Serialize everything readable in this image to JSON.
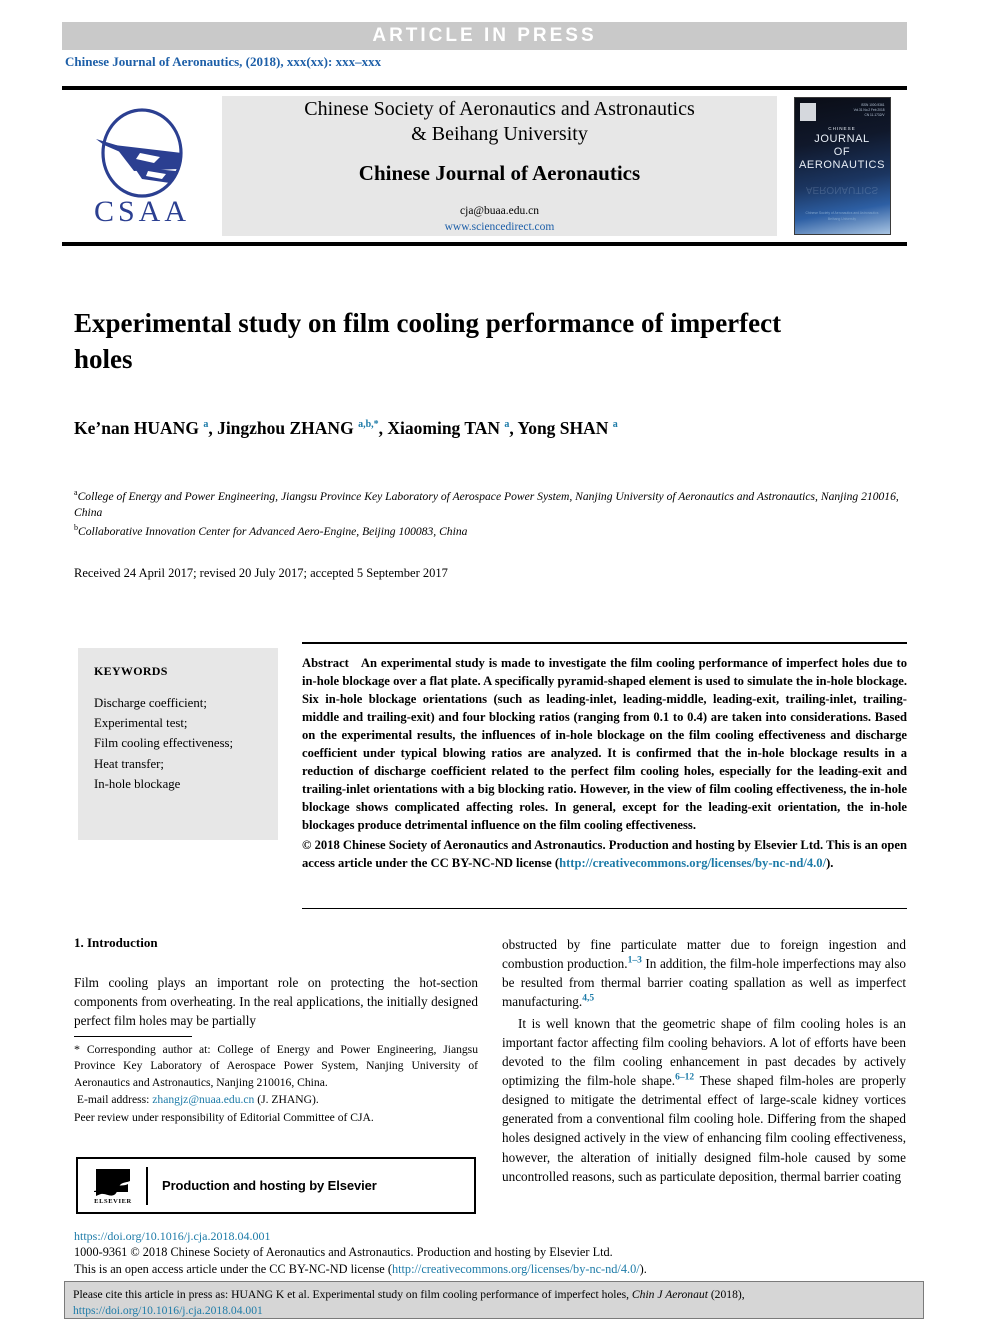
{
  "banner": {
    "text": "ARTICLE  IN  PRESS"
  },
  "running_head": "Chinese Journal of Aeronautics, (2018), xxx(xx): xxx–xxx",
  "masthead": {
    "logo_text": "CSAA",
    "society_line1": "Chinese Society of Aeronautics and Astronautics",
    "society_line2": "& Beihang University",
    "journal_name": "Chinese Journal of Aeronautics",
    "email": "cja@buaa.edu.cn",
    "url": "www.sciencedirect.com",
    "cover": {
      "chinese_label": "CHINESE",
      "title_line1": "JOURNAL",
      "title_line2": "OF",
      "title_line3": "AERONAUTICS",
      "issue_info": "ISSN 1000-9361\nVol. 31 No. 2 February 2018\nCN 11-1732/V",
      "foot_line1": "Chinese Society of Aeronautics and Astronautics",
      "foot_line2": "Beihang University"
    }
  },
  "article": {
    "title": "Experimental study on film cooling performance of imperfect holes",
    "authors_html": "Ke’nan HUANG <sup>a</sup>, Jingzhou ZHANG <sup>a,b,</sup><sup>*</sup>, Xiaoming TAN <sup>a</sup>, Yong SHAN <sup>a</sup>",
    "affiliation_a": "College of Energy and Power Engineering, Jiangsu Province Key Laboratory of Aerospace Power System, Nanjing University of Aeronautics and Astronautics, Nanjing 210016, China",
    "affiliation_b": "Collaborative Innovation Center for Advanced Aero-Engine, Beijing 100083, China",
    "dates": "Received 24 April 2017; revised 20 July 2017; accepted 5 September 2017"
  },
  "keywords": {
    "heading": "KEYWORDS",
    "items": [
      "Discharge coefficient;",
      "Experimental test;",
      "Film cooling effectiveness;",
      "Heat transfer;",
      "In-hole blockage"
    ]
  },
  "abstract": {
    "label": "Abstract",
    "text": "An experimental study is made to investigate the film cooling performance of imperfect holes due to in-hole blockage over a flat plate. A specifically pyramid-shaped element is used to simulate the in-hole blockage. Six in-hole blockage orientations (such as leading-inlet, leading-middle, leading-exit, trailing-inlet, trailing-middle and trailing-exit) and four blocking ratios (ranging from 0.1 to 0.4) are taken into considerations. Based on the experimental results, the influences of in-hole blockage on the film cooling effectiveness and discharge coefficient under typical blowing ratios are analyzed. It is confirmed that the in-hole blockage results in a reduction of discharge coefficient related to the perfect film cooling holes, especially for the leading-exit and trailing-inlet orientations with a big blocking ratio. However, in the view of film cooling effectiveness, the in-hole blockage shows complicated affecting roles. In general, except for the leading-exit orientation, the in-hole blockages produce detrimental influence on the film cooling effectiveness.",
    "copyright_pre": "© 2018 Chinese Society of Aeronautics and Astronautics. Production and hosting by Elsevier Ltd. This is an open access article under the CC BY-NC-ND license (",
    "copyright_link": "http://creativecommons.org/licenses/by-nc-nd/4.0/",
    "copyright_post": ")."
  },
  "introduction": {
    "heading": "1. Introduction",
    "para1": "Film cooling plays an important role on protecting the hot-section components from overheating. In the real applications, the initially designed perfect film holes may be partially"
  },
  "right_column": {
    "para1_a": "obstructed by fine particulate matter due to foreign ingestion and combustion production.",
    "para1_ref1": "1–3",
    "para1_b": " In addition, the film-hole imperfections may also be resulted from thermal barrier coating spallation as well as imperfect manufacturing.",
    "para1_ref2": "4,5",
    "para2_a": "It is well known that the geometric shape of film cooling holes is an important factor affecting film cooling behaviors. A lot of efforts have been devoted to the film cooling enhancement in past decades by actively optimizing the film-hole shape.",
    "para2_ref": "6–12",
    "para2_b": " These shaped film-holes are properly designed to mitigate the detrimental effect of large-scale kidney vortices generated from a conventional film cooling hole. Differing from the shaped holes designed actively in the view of enhancing film cooling effectiveness, however, the alteration of initially designed film-hole caused by some uncontrolled reasons, such as particulate deposition, thermal barrier coating"
  },
  "footnote": {
    "corresponding": "Corresponding author at: College of Energy and Power Engineering, Jiangsu Province Key Laboratory of Aerospace Power System, Nanjing University of Aeronautics and Astronautics, Nanjing 210016, China.",
    "email_label": "E-mail address:",
    "email": "zhangjz@nuaa.edu.cn",
    "email_suffix": "(J. ZHANG).",
    "peer_review": "Peer review under responsibility of Editorial Committee of CJA."
  },
  "elsevier_box": {
    "logo_word": "ELSEVIER",
    "text": "Production and hosting by Elsevier"
  },
  "footer": {
    "doi": "https://doi.org/10.1016/j.cja.2018.04.001",
    "issn_line": "1000-9361 © 2018 Chinese Society of Aeronautics and Astronautics. Production and hosting by Elsevier Ltd.",
    "license_pre": "This is an open access article under the CC BY-NC-ND license (",
    "license_link": "http://creativecommons.org/licenses/by-nc-nd/4.0/",
    "license_post": ")."
  },
  "citation_box": {
    "pre": "Please cite this article in press as: HUANG K et al. Experimental study on film cooling performance of imperfect holes, ",
    "journal_italic": "Chin J Aeronaut",
    "mid": " (2018), ",
    "link": "https://doi.org/10.1016/j.cja.2018.04.001"
  },
  "colors": {
    "banner_bg": "#c9c9c9",
    "link_blue": "#1d7ba8",
    "header_blue": "#1d5fa8",
    "logo_blue": "#2b3f91",
    "panel_gray": "#e7e7e7",
    "cite_gray": "#d6d6d6"
  }
}
